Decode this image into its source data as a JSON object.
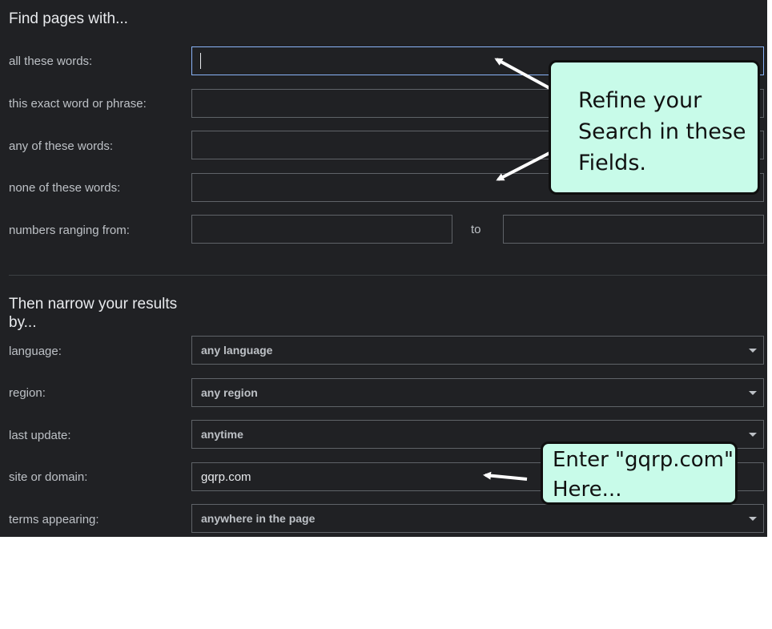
{
  "find_section": {
    "heading": "Find pages with...",
    "fields": [
      {
        "label": "all these words:",
        "value": ""
      },
      {
        "label": "this exact word or phrase:",
        "value": ""
      },
      {
        "label": "any of these words:",
        "value": ""
      },
      {
        "label": "none of these words:",
        "value": ""
      }
    ],
    "range": {
      "label": "numbers ranging from:",
      "from_value": "",
      "to_label": "to",
      "to_value": ""
    }
  },
  "narrow_section": {
    "heading": "Then narrow your results\nby...",
    "language": {
      "label": "language:",
      "value": "any language"
    },
    "region": {
      "label": "region:",
      "value": "any region"
    },
    "last_update": {
      "label": "last update:",
      "value": "anytime"
    },
    "site": {
      "label": "site or domain:",
      "value": "gqrp.com"
    },
    "terms": {
      "label": "terms appearing:",
      "value": "anywhere in the page"
    }
  },
  "annotations": {
    "callout_refine": "Refine your\nSearch in these\nFields.",
    "callout_site": "Enter \"gqrp.com\"\nHere..."
  }
}
